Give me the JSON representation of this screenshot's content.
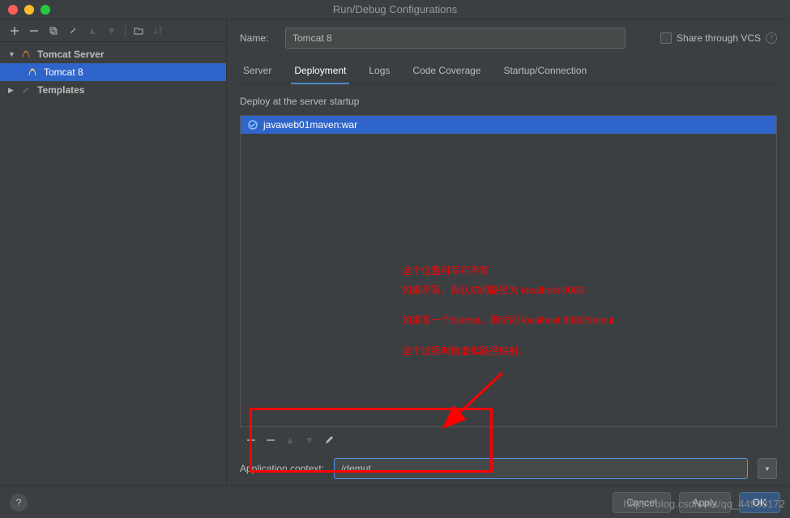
{
  "window": {
    "title": "Run/Debug Configurations"
  },
  "sidebar": {
    "items": [
      {
        "label": "Tomcat Server",
        "expanded": true,
        "icon": "tomcat"
      },
      {
        "label": "Tomcat 8",
        "selected": true,
        "icon": "tomcat"
      },
      {
        "label": "Templates",
        "expanded": false,
        "icon": "templates"
      }
    ]
  },
  "form": {
    "name_label": "Name:",
    "name_value": "Tomcat 8",
    "share_label": "Share through VCS"
  },
  "tabs": {
    "items": [
      {
        "label": "Server"
      },
      {
        "label": "Deployment",
        "active": true
      },
      {
        "label": "Logs"
      },
      {
        "label": "Code Coverage"
      },
      {
        "label": "Startup/Connection"
      }
    ]
  },
  "deploy": {
    "label": "Deploy at the server startup",
    "items": [
      {
        "label": "javaweb01maven:war"
      }
    ]
  },
  "context": {
    "label": "Application context:",
    "value": "/demut"
  },
  "annotations": {
    "line1": "这个位置可写可不写",
    "line2": "如果不写，默认访问路径为 localhost:8080",
    "line3": "如果写一个/demut，则访问 localhost:8080/demut",
    "line4": "这个过程叫做虚拟路径映射。"
  },
  "buttons": {
    "cancel": "Cancel",
    "apply": "Apply",
    "ok": "OK"
  },
  "watermark": "https://blog.csdn.net/qq_44988172"
}
